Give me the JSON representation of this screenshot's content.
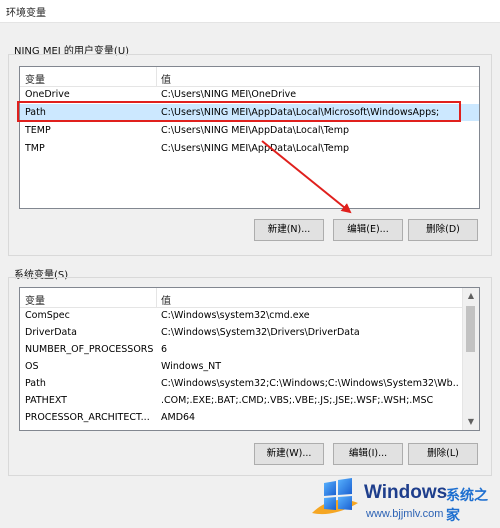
{
  "window": {
    "title": "环境变量"
  },
  "user_vars": {
    "section_label": "NING MEI 的用户变量(U)",
    "headers": {
      "name": "变量",
      "value": "值"
    },
    "rows": [
      {
        "name": "OneDrive",
        "value": "C:\\Users\\NING MEI\\OneDrive"
      },
      {
        "name": "Path",
        "value": "C:\\Users\\NING MEI\\AppData\\Local\\Microsoft\\WindowsApps;"
      },
      {
        "name": "TEMP",
        "value": "C:\\Users\\NING MEI\\AppData\\Local\\Temp"
      },
      {
        "name": "TMP",
        "value": "C:\\Users\\NING MEI\\AppData\\Local\\Temp"
      }
    ],
    "buttons": {
      "new": "新建(N)...",
      "edit": "编辑(E)...",
      "delete": "删除(D)"
    }
  },
  "system_vars": {
    "section_label": "系统变量(S)",
    "headers": {
      "name": "变量",
      "value": "值"
    },
    "rows": [
      {
        "name": "ComSpec",
        "value": "C:\\Windows\\system32\\cmd.exe"
      },
      {
        "name": "DriverData",
        "value": "C:\\Windows\\System32\\Drivers\\DriverData"
      },
      {
        "name": "NUMBER_OF_PROCESSORS",
        "value": "6"
      },
      {
        "name": "OS",
        "value": "Windows_NT"
      },
      {
        "name": "Path",
        "value": "C:\\Windows\\system32;C:\\Windows;C:\\Windows\\System32\\Wb..."
      },
      {
        "name": "PATHEXT",
        "value": ".COM;.EXE;.BAT;.CMD;.VBS;.VBE;.JS;.JSE;.WSF;.WSH;.MSC"
      },
      {
        "name": "PROCESSOR_ARCHITECT...",
        "value": "AMD64"
      }
    ],
    "buttons": {
      "new": "新建(W)...",
      "edit": "编辑(I)...",
      "delete": "删除(L)"
    }
  },
  "watermark": {
    "brand": "Windows",
    "brand_cn": "系统之家",
    "url": "www.bjjmlv.com"
  },
  "colors": {
    "selection": "#cce8ff",
    "highlight": "#e0201d",
    "brand_blue": "#1e6fd0"
  }
}
